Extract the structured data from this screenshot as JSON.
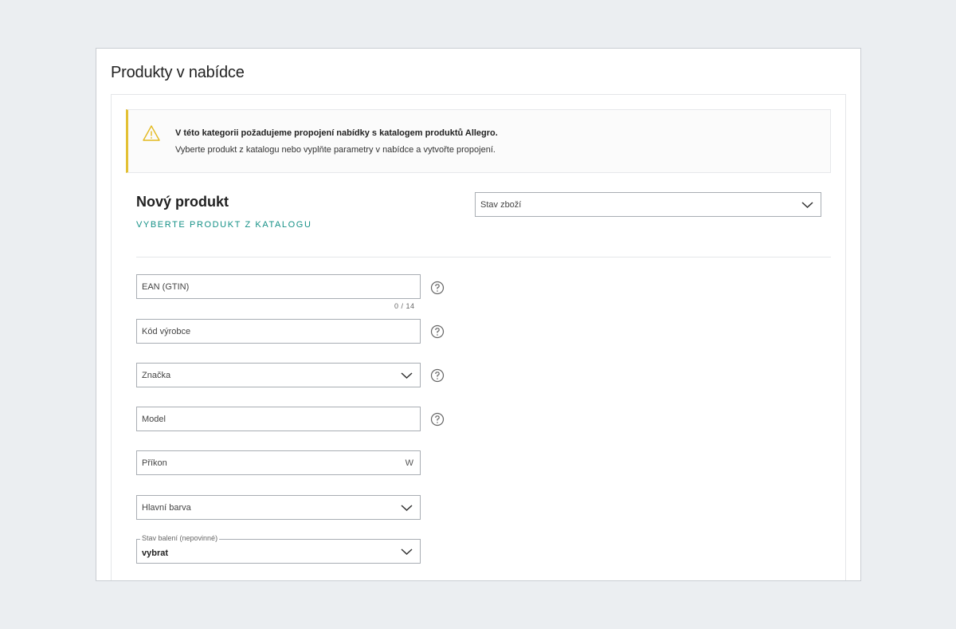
{
  "page_title": "Produkty v nabídce",
  "alert": {
    "title": "V této kategorii požadujeme propojení nabídky s katalogem produktů Allegro.",
    "text": "Vyberte produkt z katalogu nebo vyplňte parametry v nabídce a vytvořte propojení.",
    "icon": "warning-icon",
    "accent_color": "#e3c033"
  },
  "new_product": {
    "title": "Nový produkt",
    "catalog_link": "VYBERTE PRODUKT Z KATALOGU"
  },
  "condition_select": {
    "placeholder": "Stav zboží"
  },
  "fields": {
    "ean": {
      "placeholder": "EAN (GTIN)",
      "counter": "0 / 14"
    },
    "manufacturer_code": {
      "placeholder": "Kód výrobce"
    },
    "brand": {
      "placeholder": "Značka"
    },
    "model": {
      "placeholder": "Model"
    },
    "power": {
      "placeholder": "Příkon",
      "unit": "W"
    },
    "main_color": {
      "placeholder": "Hlavní barva"
    },
    "packaging": {
      "legend": "Stav balení (nepovinné)",
      "value": "vybrat"
    }
  },
  "colors": {
    "link": "#149086",
    "border": "#a8adb3"
  }
}
